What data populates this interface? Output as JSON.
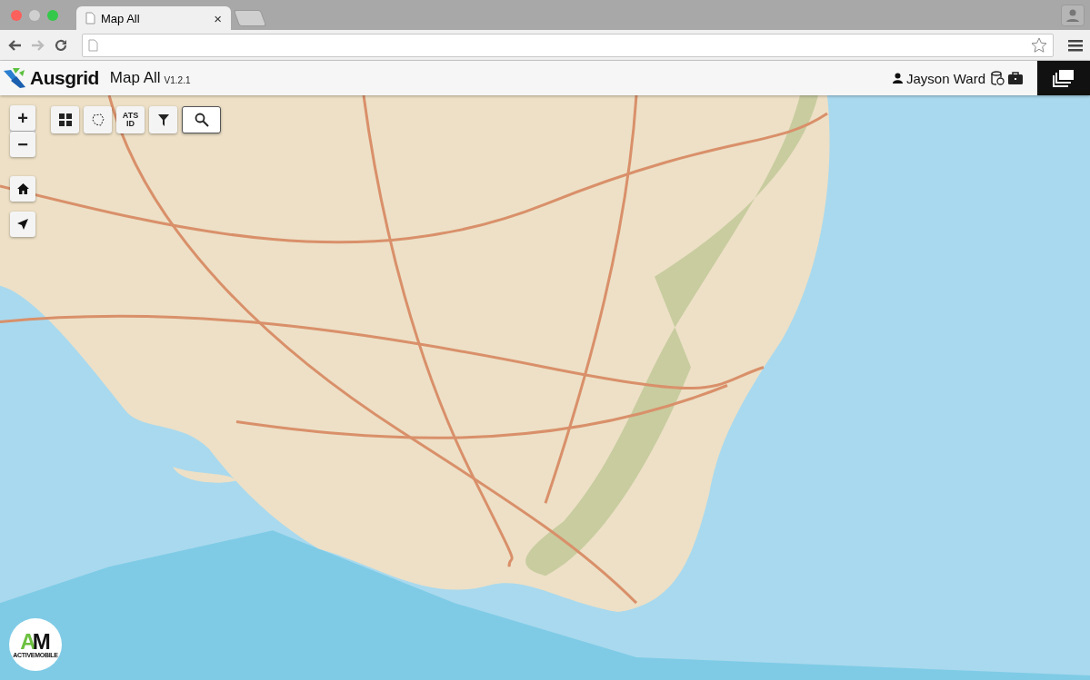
{
  "browser": {
    "tabs": [
      {
        "label": "Map All",
        "selected": true
      },
      {
        "selected": false
      }
    ],
    "close_glyph": "×"
  },
  "header": {
    "brand": "Ausgrid",
    "title": "Map All",
    "version": "V1.2.1",
    "user": "Jayson Ward"
  },
  "tools": [
    {
      "kind": "grid",
      "selected": false
    },
    {
      "kind": "lasso",
      "selected": false
    },
    {
      "kind": "ats",
      "lines": [
        "ATS",
        "ID"
      ],
      "selected": false
    },
    {
      "kind": "filter",
      "selected": false
    },
    {
      "kind": "search",
      "selected": true
    }
  ],
  "zoom": {
    "in": "+",
    "out": "−"
  },
  "logo": {
    "letters": [
      "A",
      "M"
    ],
    "caption": "ACTIVEMOBILE"
  }
}
